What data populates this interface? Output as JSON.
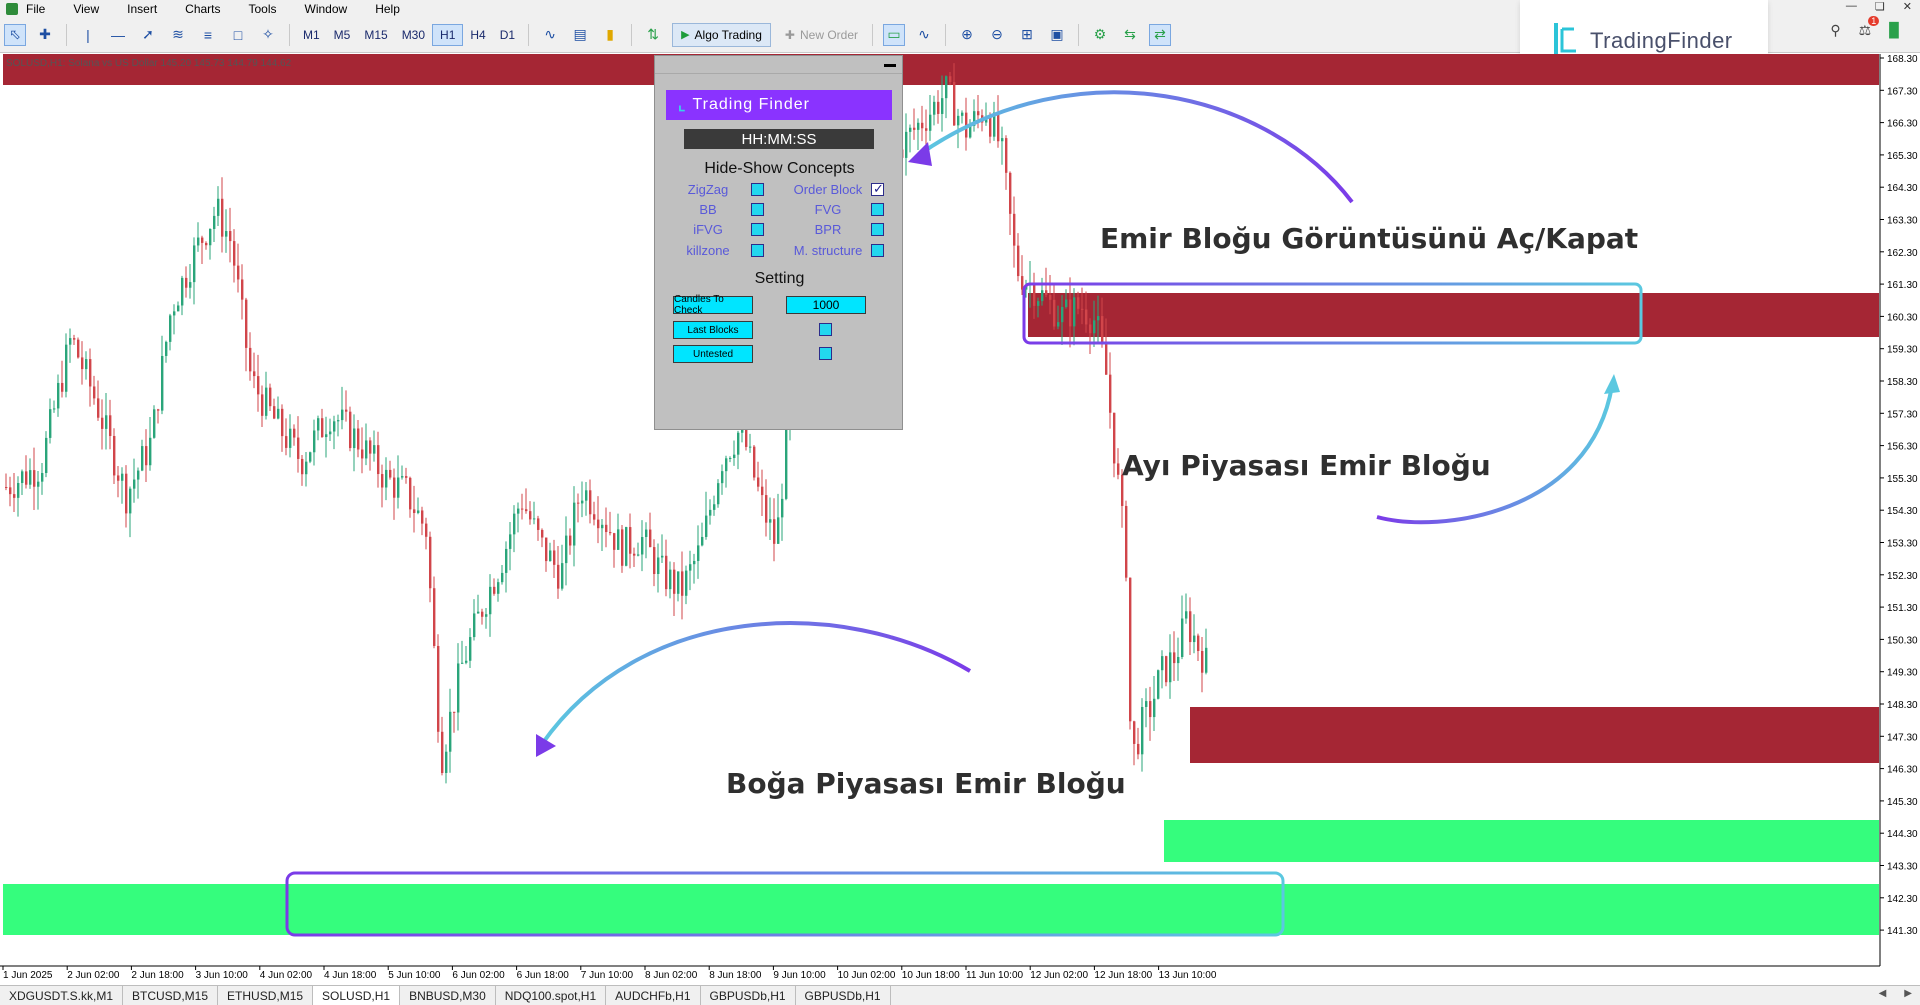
{
  "menu": {
    "items": [
      "File",
      "View",
      "Insert",
      "Charts",
      "Tools",
      "Window",
      "Help"
    ]
  },
  "toolbar": {
    "timeframes": [
      "M1",
      "M5",
      "M15",
      "M30",
      "H1",
      "H4",
      "D1"
    ],
    "active_timeframe": "H1",
    "algo_trading_label": "Algo Trading",
    "new_order_label": "New Order"
  },
  "brand": {
    "name": "TradingFinder",
    "notification_count": "1"
  },
  "chart": {
    "symbol_info": "SOLUSD,H1: Solana vs US Dollar 145.20 145.73 144.79 144.62",
    "price_labels": [
      "168.30",
      "167.30",
      "166.30",
      "165.30",
      "164.30",
      "163.30",
      "162.30",
      "161.30",
      "160.30",
      "159.30",
      "158.30",
      "157.30",
      "156.30",
      "155.30",
      "154.30",
      "153.30",
      "152.30",
      "151.30",
      "150.30",
      "149.30",
      "148.30",
      "147.30",
      "146.30",
      "145.30",
      "144.30",
      "143.30",
      "142.30",
      "141.30"
    ],
    "time_labels": [
      "1 Jun 2025",
      "2 Jun 02:00",
      "2 Jun 18:00",
      "3 Jun 10:00",
      "4 Jun 02:00",
      "4 Jun 18:00",
      "5 Jun 10:00",
      "6 Jun 02:00",
      "6 Jun 18:00",
      "7 Jun 10:00",
      "8 Jun 02:00",
      "8 Jun 18:00",
      "9 Jun 10:00",
      "10 Jun 02:00",
      "10 Jun 18:00",
      "11 Jun 10:00",
      "12 Jun 02:00",
      "12 Jun 18:00",
      "13 Jun 10:00"
    ],
    "colors": {
      "bear_block": "#a52634",
      "bull_block": "#35fd7d",
      "candle_up": "#2aa57a",
      "candle_down": "#d1454a",
      "highlight_purple": "#7b3be8",
      "highlight_cyan": "#5bc8e0"
    }
  },
  "panel": {
    "logo_text": "Trading Finder",
    "clock": "HH:MM:SS",
    "concepts_title": "Hide-Show Concepts",
    "concepts": [
      {
        "label": "ZigZag",
        "checked": false
      },
      {
        "label": "Order Block",
        "checked": true
      },
      {
        "label": "BB",
        "checked": false
      },
      {
        "label": "FVG",
        "checked": false
      },
      {
        "label": "iFVG",
        "checked": false
      },
      {
        "label": "BPR",
        "checked": false
      },
      {
        "label": "killzone",
        "checked": false
      },
      {
        "label": "M. structure",
        "checked": false
      }
    ],
    "setting_title": "Setting",
    "settings": {
      "candles_label": "Candles To Check",
      "candles_value": "1000",
      "last_blocks_label": "Last Blocks",
      "untested_label": "Untested"
    }
  },
  "annotations": {
    "toggle": "Emir Bloğu Görüntüsünü Aç/Kapat",
    "bear": "Ayı Piyasası Emir Bloğu",
    "bull": "Boğa Piyasası Emir Bloğu"
  },
  "tabs": {
    "items": [
      "XDGUSDT.S.kk,M1",
      "BTCUSD,M15",
      "ETHUSD,M15",
      "SOLUSD,H1",
      "BNBUSD,M30",
      "NDQ100.spot,H1",
      "AUDCHFb,H1",
      "GBPUSDb,H1",
      "GBPUSDb,H1"
    ],
    "active": "SOLUSD,H1"
  }
}
